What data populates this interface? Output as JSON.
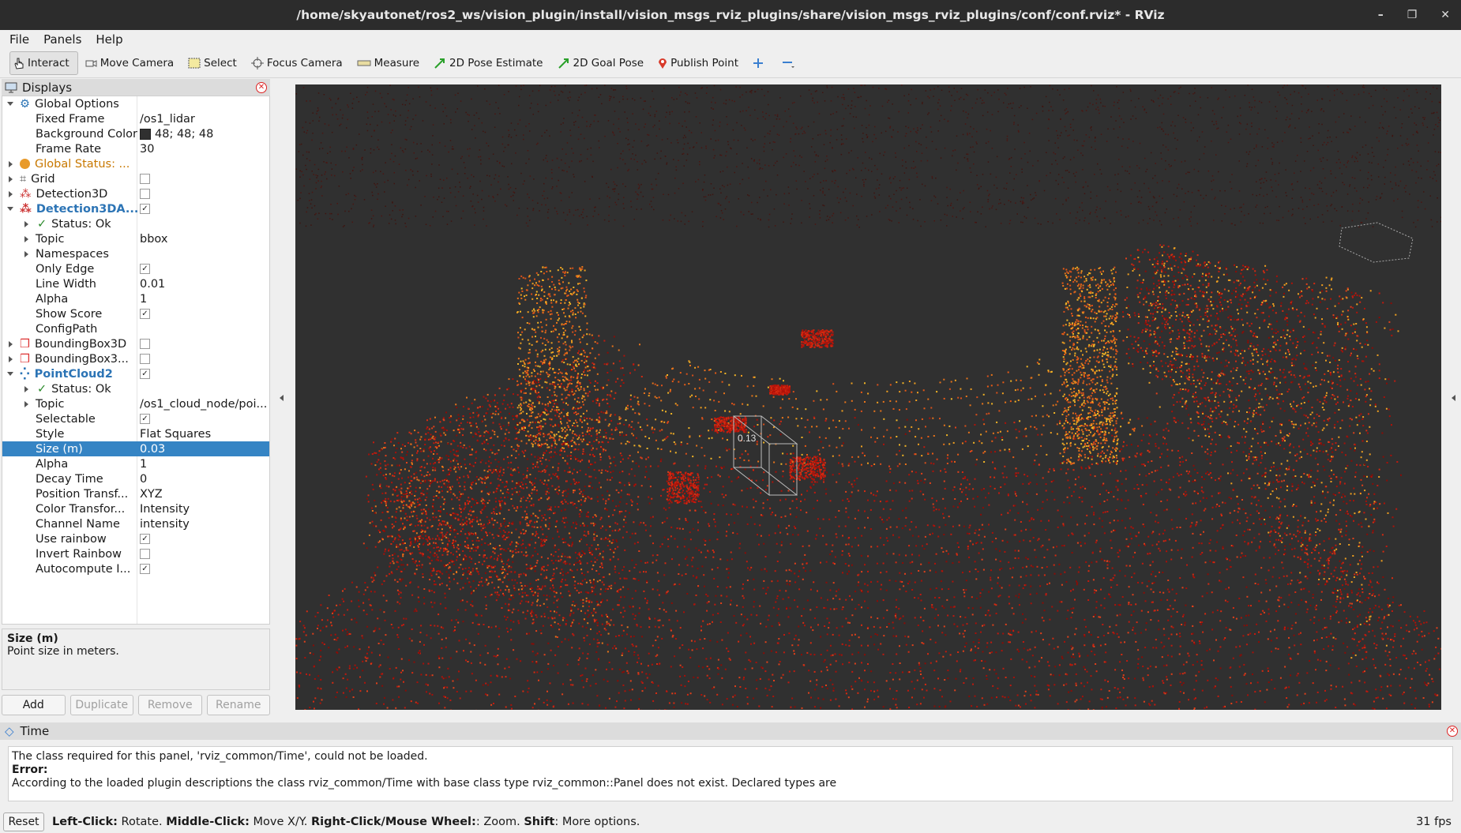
{
  "window": {
    "title": "/home/skyautonet/ros2_ws/vision_plugin/install/vision_msgs_rviz_plugins/share/vision_msgs_rviz_plugins/conf/conf.rviz* - RViz"
  },
  "menu": [
    "File",
    "Panels",
    "Help"
  ],
  "toolbar": {
    "interact": "Interact",
    "move_camera": "Move Camera",
    "select": "Select",
    "focus_camera": "Focus Camera",
    "measure": "Measure",
    "pose_estimate": "2D Pose Estimate",
    "goal_pose": "2D Goal Pose",
    "publish_point": "Publish Point"
  },
  "displays": {
    "title": "Displays",
    "rows": [
      {
        "name": "Global Options",
        "value": ""
      },
      {
        "name": "Fixed Frame",
        "value": "/os1_lidar"
      },
      {
        "name": "Background Color",
        "value": "48; 48; 48"
      },
      {
        "name": "Frame Rate",
        "value": "30"
      },
      {
        "name": "Global Status: ...",
        "value": ""
      },
      {
        "name": "Grid",
        "value": ""
      },
      {
        "name": "Detection3D",
        "value": ""
      },
      {
        "name": "Detection3DA...",
        "value": ""
      },
      {
        "name": "Status: Ok",
        "value": ""
      },
      {
        "name": "Topic",
        "value": "bbox"
      },
      {
        "name": "Namespaces",
        "value": ""
      },
      {
        "name": "Only Edge",
        "value": ""
      },
      {
        "name": "Line Width",
        "value": "0.01"
      },
      {
        "name": "Alpha",
        "value": "1"
      },
      {
        "name": "Show Score",
        "value": ""
      },
      {
        "name": "ConfigPath",
        "value": ""
      },
      {
        "name": "BoundingBox3D",
        "value": ""
      },
      {
        "name": "BoundingBox3...",
        "value": ""
      },
      {
        "name": "PointCloud2",
        "value": ""
      },
      {
        "name": "Status: Ok",
        "value": ""
      },
      {
        "name": "Topic",
        "value": "/os1_cloud_node/poi..."
      },
      {
        "name": "Selectable",
        "value": ""
      },
      {
        "name": "Style",
        "value": "Flat Squares"
      },
      {
        "name": "Size (m)",
        "value": "0.03"
      },
      {
        "name": "Alpha",
        "value": "1"
      },
      {
        "name": "Decay Time",
        "value": "0"
      },
      {
        "name": "Position Transf...",
        "value": "XYZ"
      },
      {
        "name": "Color Transfor...",
        "value": "Intensity"
      },
      {
        "name": "Channel Name",
        "value": "intensity"
      },
      {
        "name": "Use rainbow",
        "value": ""
      },
      {
        "name": "Invert Rainbow",
        "value": ""
      },
      {
        "name": "Autocompute I...",
        "value": ""
      }
    ],
    "description_title": "Size (m)",
    "description_text": "Point size in meters.",
    "buttons": {
      "add": "Add",
      "duplicate": "Duplicate",
      "remove": "Remove",
      "rename": "Rename"
    }
  },
  "viewport": {
    "bbox_label": "0.13",
    "background_color": "#303030"
  },
  "time_panel": {
    "title": "Time",
    "line1": "The class required for this panel, 'rviz_common/Time', could not be loaded.",
    "error_label": "Error:",
    "line2": "According to the loaded plugin descriptions the class rviz_common/Time with base class type rviz_common::Panel does not exist. Declared types are"
  },
  "status": {
    "reset": "Reset",
    "lc": "Left-Click:",
    "lc_t": " Rotate. ",
    "mc": "Middle-Click:",
    "mc_t": " Move X/Y. ",
    "rc": "Right-Click/Mouse Wheel:",
    "rc_t": ": Zoom. ",
    "sh": "Shift",
    "sh_t": ": More options.",
    "fps": "31 fps"
  }
}
